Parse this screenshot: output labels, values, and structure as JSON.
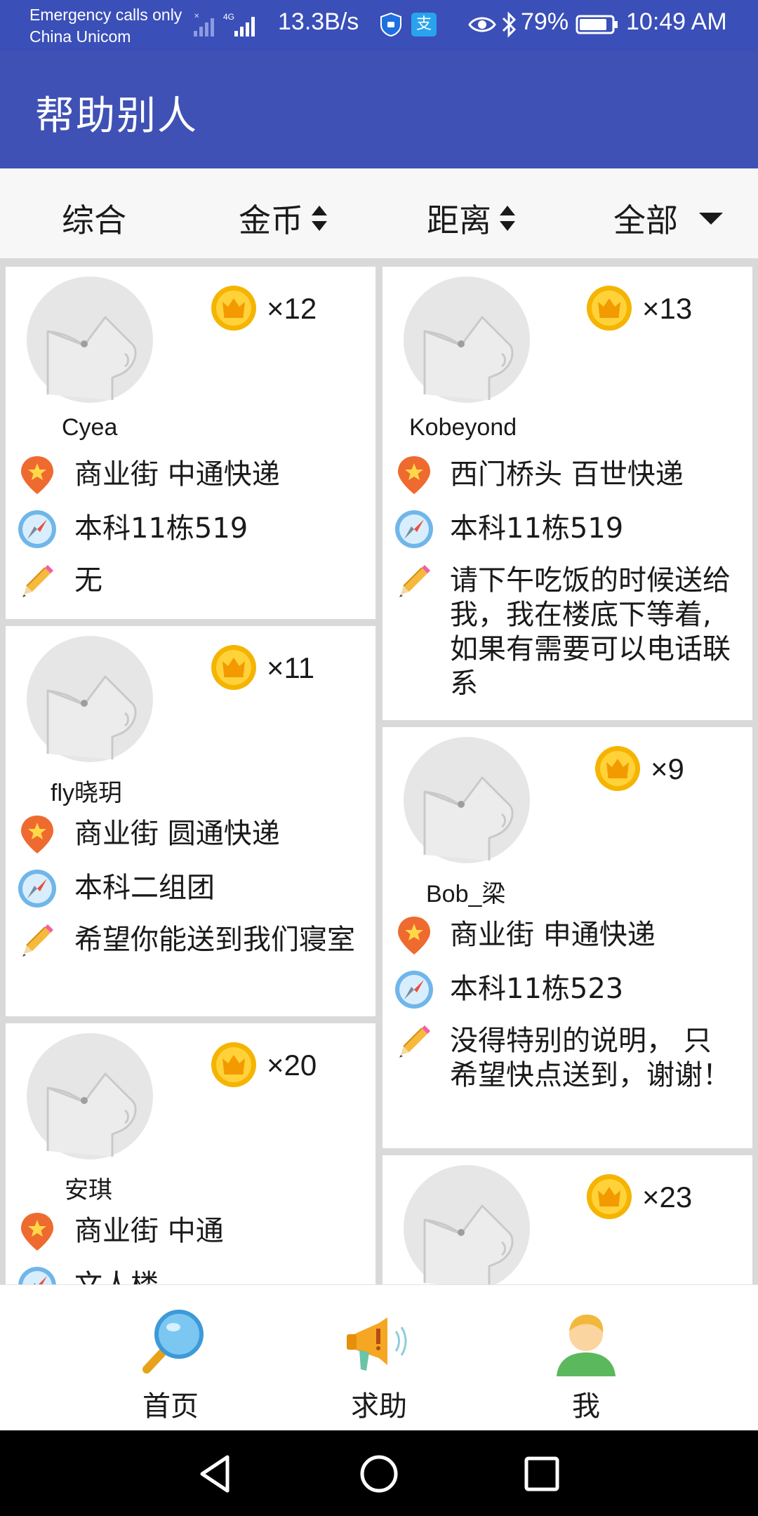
{
  "status_bar": {
    "carrier_line1": "Emergency calls only",
    "carrier_line2": "China Unicom",
    "net_speed": "13.3B/s",
    "battery_pct": "79%",
    "time": "10:49 AM",
    "alipay_glyph": "支"
  },
  "app_bar": {
    "title": "帮助别人"
  },
  "filters": {
    "overall": "综合",
    "coins": "金币",
    "distance": "距离",
    "all": "全部"
  },
  "cards": [
    {
      "username": "Cyea",
      "coins": "×12",
      "pickup": "商业街 中通快递",
      "destination": "本科11栋519",
      "note": "无"
    },
    {
      "username": "fly晓玥",
      "coins": "×11",
      "pickup": "商业街 圆通快递",
      "destination": "本科二组团",
      "note": "希望你能送到我们寝室"
    },
    {
      "username": "安琪",
      "coins": "×20",
      "pickup": "商业街 中通",
      "destination": "文人楼"
    },
    {
      "username": "Kobeyond",
      "coins": "×13",
      "pickup": "西门桥头 百世快递",
      "destination": "本科11栋519",
      "note": "请下午吃饭的时候送给我，我在楼底下等着,如果有需要可以电话联系"
    },
    {
      "username": "Bob_梁",
      "coins": "×9",
      "pickup": "商业街 申通快递",
      "destination": "本科11栋523",
      "note": "没得特别的说明， 只希望快点送到，谢谢！"
    },
    {
      "coins": "×23"
    }
  ],
  "bottom_nav": {
    "home": "首页",
    "help": "求助",
    "me": "我"
  },
  "icons": {
    "coin": "coin-crown-icon",
    "pickup": "location-pin-icon",
    "destination": "compass-icon",
    "note": "pencil-icon",
    "home": "magnifier-icon",
    "help": "megaphone-icon",
    "me": "user-icon"
  },
  "colors": {
    "primary": "#3f51b5",
    "status_bar": "#3a4fb8",
    "coin": "#f5b400",
    "pin": "#ef6a2f"
  }
}
